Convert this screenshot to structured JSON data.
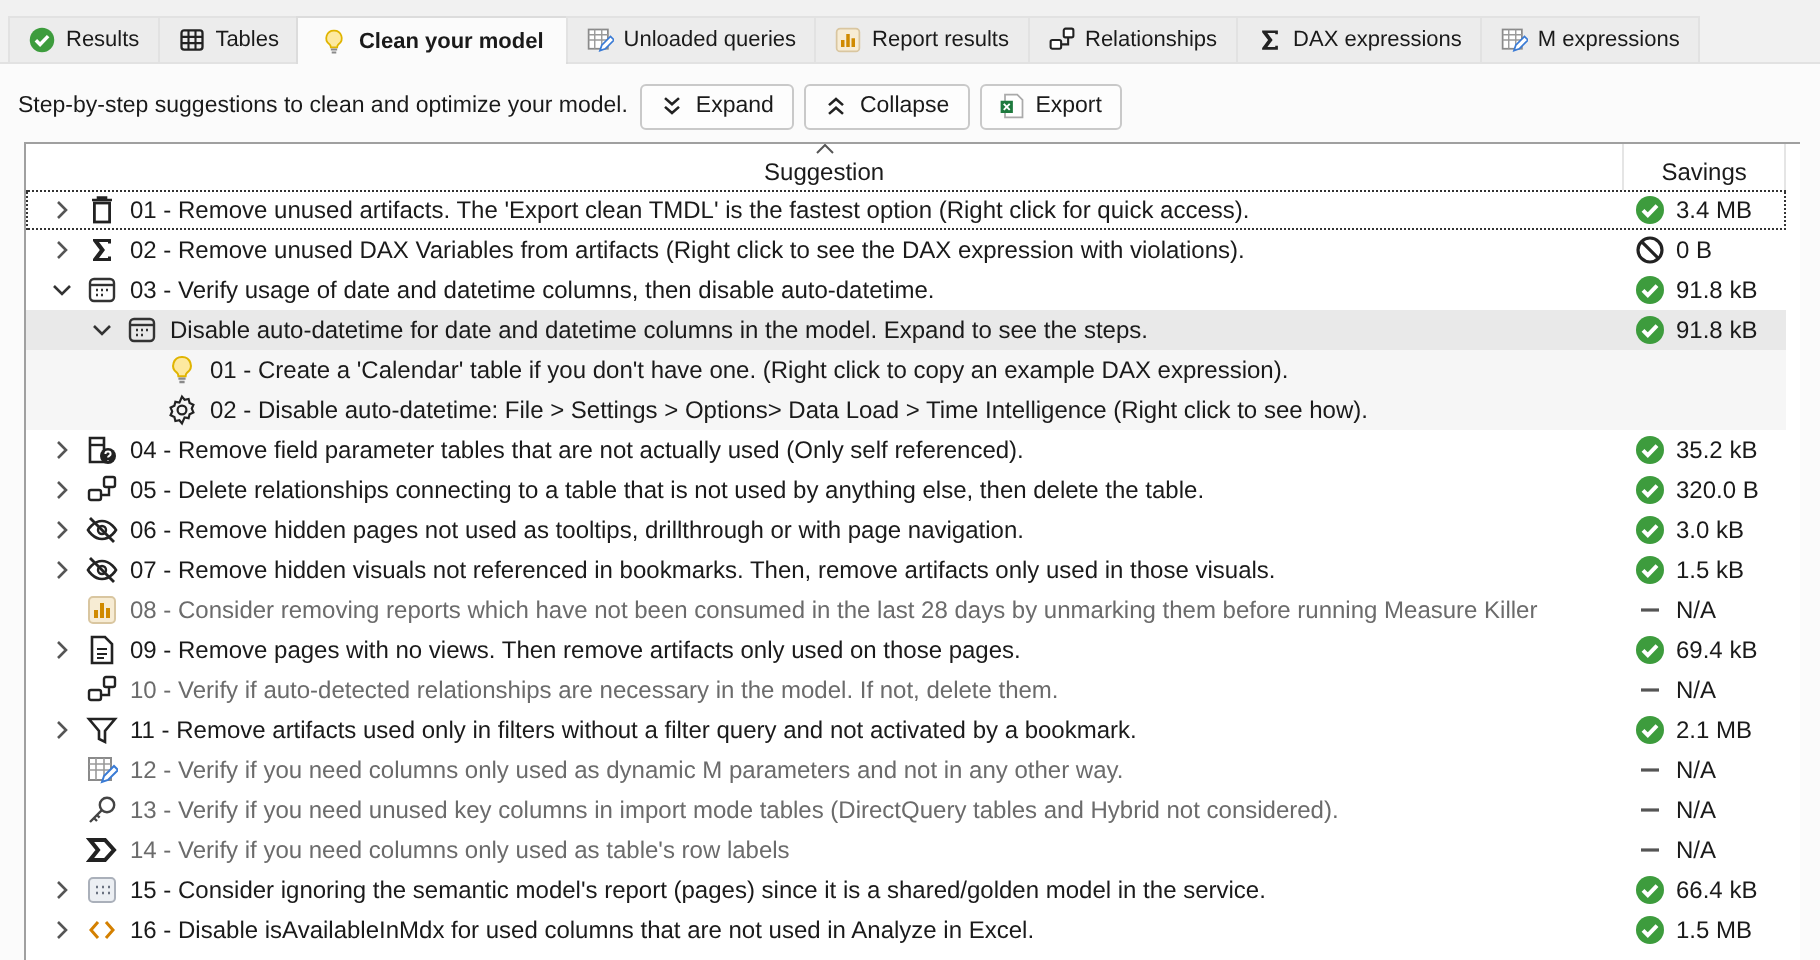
{
  "tabs": [
    {
      "label": "Results",
      "kind": "check",
      "selected": false
    },
    {
      "label": "Tables",
      "kind": "grid",
      "selected": false
    },
    {
      "label": "Clean your model",
      "kind": "bulb",
      "selected": true
    },
    {
      "label": "Unloaded queries",
      "kind": "tablepen",
      "selected": false
    },
    {
      "label": "Report results",
      "kind": "chart",
      "selected": false
    },
    {
      "label": "Relationships",
      "kind": "rel",
      "selected": false
    },
    {
      "label": "DAX expressions",
      "kind": "sigma",
      "selected": false
    },
    {
      "label": "M expressions",
      "kind": "tablepen",
      "selected": false
    }
  ],
  "toolbar": {
    "description": "Step-by-step suggestions to clean and optimize your model.",
    "buttons": [
      {
        "label": "Expand",
        "kind": "expand"
      },
      {
        "label": "Collapse",
        "kind": "collapse"
      },
      {
        "label": "Export",
        "kind": "excel"
      }
    ]
  },
  "table": {
    "columns": [
      {
        "label": "Suggestion",
        "sorted": true
      },
      {
        "label": "Savings",
        "sorted": false
      }
    ],
    "rows": [
      {
        "kind": "trash",
        "text": "01 - Remove unused artifacts. The 'Export clean TMDL' is the fastest option (Right click for quick access).",
        "savings": {
          "kind": "ok",
          "value": "3.4 MB"
        },
        "expanded": false,
        "disabled": false,
        "focused": true,
        "selected": false
      },
      {
        "kind": "sigma",
        "text": "02 - Remove unused DAX Variables from artifacts (Right click to see the DAX expression with violations).",
        "savings": {
          "kind": "none",
          "value": "0 B"
        },
        "expanded": false,
        "disabled": false,
        "focused": false,
        "selected": false
      },
      {
        "kind": "calendar",
        "text": "03 - Verify usage of date and datetime columns, then disable auto-datetime.",
        "savings": {
          "kind": "ok",
          "value": "91.8 kB"
        },
        "expanded": true,
        "disabled": false,
        "focused": false,
        "selected": false,
        "children": [
          {
            "kind": "calendar",
            "text": "Disable auto-datetime for date and datetime columns in the model. Expand to see the steps.",
            "savings": {
              "kind": "ok",
              "value": "91.8 kB"
            },
            "expanded": true,
            "disabled": false,
            "focused": false,
            "selected": true,
            "children": [
              {
                "kind": "bulb",
                "text": "01 - Create a 'Calendar' table if you don't have one. (Right click to copy an example DAX expression).",
                "disabled": false,
                "focused": false,
                "selected": false
              },
              {
                "kind": "gear",
                "text": "02 - Disable auto-datetime: File > Settings > Options> Data Load > Time Intelligence (Right click to see how).",
                "disabled": false,
                "focused": false,
                "selected": false
              }
            ]
          }
        ]
      },
      {
        "kind": "tablequestion",
        "text": "04 - Remove field parameter tables that are not actually used (Only self referenced).",
        "savings": {
          "kind": "ok",
          "value": "35.2 kB"
        },
        "expanded": false,
        "disabled": false,
        "focused": false,
        "selected": false
      },
      {
        "kind": "rel",
        "text": "05 - Delete relationships connecting to a table that is not used by anything else, then delete the table.",
        "savings": {
          "kind": "ok",
          "value": "320.0 B"
        },
        "expanded": false,
        "disabled": false,
        "focused": false,
        "selected": false
      },
      {
        "kind": "hidden",
        "text": "06 - Remove hidden pages not used as tooltips, drillthrough or with page navigation.",
        "savings": {
          "kind": "ok",
          "value": "3.0 kB"
        },
        "expanded": false,
        "disabled": false,
        "focused": false,
        "selected": false
      },
      {
        "kind": "hidden",
        "text": "07 - Remove hidden visuals not referenced in bookmarks. Then, remove artifacts only used in those visuals.",
        "savings": {
          "kind": "ok",
          "value": "1.5 kB"
        },
        "expanded": false,
        "disabled": false,
        "focused": false,
        "selected": false
      },
      {
        "kind": "chart",
        "text": "08 - Consider removing reports which have not been consumed in the last 28 days by unmarking them before running Measure Killer",
        "savings": {
          "kind": "na",
          "value": "N/A"
        },
        "disabled": true,
        "focused": false,
        "selected": false
      },
      {
        "kind": "document",
        "text": "09 - Remove pages with no views. Then remove artifacts only used on those pages.",
        "savings": {
          "kind": "ok",
          "value": "69.4 kB"
        },
        "expanded": false,
        "disabled": false,
        "focused": false,
        "selected": false
      },
      {
        "kind": "rel",
        "text": "10 - Verify if auto-detected relationships are necessary in the model. If not, delete them.",
        "savings": {
          "kind": "na",
          "value": "N/A"
        },
        "disabled": true,
        "focused": false,
        "selected": false
      },
      {
        "kind": "filter",
        "text": "11 - Remove artifacts used only in filters without a filter query and not activated by a bookmark.",
        "savings": {
          "kind": "ok",
          "value": "2.1 MB"
        },
        "expanded": false,
        "disabled": false,
        "focused": false,
        "selected": false
      },
      {
        "kind": "tablepen",
        "text": "12 - Verify if you need columns only used as dynamic M parameters and not in any other way.",
        "savings": {
          "kind": "na",
          "value": "N/A"
        },
        "disabled": true,
        "focused": false,
        "selected": false
      },
      {
        "kind": "key",
        "text": "13 - Verify if you need unused key columns in import mode tables (DirectQuery tables and Hybrid not considered).",
        "savings": {
          "kind": "na",
          "value": "N/A"
        },
        "disabled": true,
        "focused": false,
        "selected": false
      },
      {
        "kind": "tag",
        "text": "14 - Verify if you need columns only used as table's row labels",
        "savings": {
          "kind": "na",
          "value": "N/A"
        },
        "disabled": true,
        "focused": false,
        "selected": false
      },
      {
        "kind": "window",
        "text": "15 - Consider ignoring the semantic model's report (pages) since it is a shared/golden model in the service.",
        "savings": {
          "kind": "ok",
          "value": "66.4 kB"
        },
        "expanded": false,
        "disabled": false,
        "focused": false,
        "selected": false
      },
      {
        "kind": "code",
        "text": "16 - Disable isAvailableInMdx for used columns that are not used in Analyze in Excel.",
        "savings": {
          "kind": "ok",
          "value": "1.5 MB"
        },
        "expanded": false,
        "disabled": false,
        "focused": false,
        "selected": false
      }
    ]
  }
}
